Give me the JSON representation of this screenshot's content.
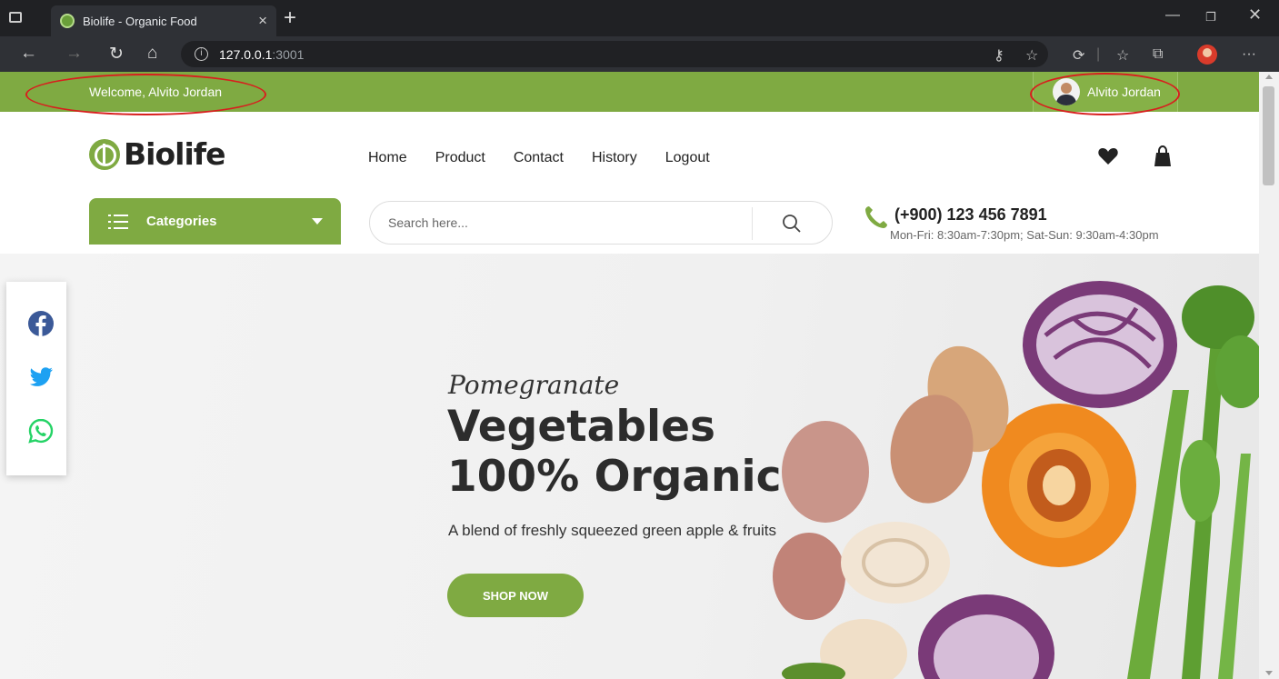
{
  "browser": {
    "tab_title": "Biolife - Organic Food",
    "url_host": "127.0.0.1",
    "url_port": ":3001"
  },
  "topbar": {
    "welcome": "Welcome, Alvito Jordan",
    "username": "Alvito Jordan"
  },
  "header": {
    "logo": "Biolife",
    "nav": [
      "Home",
      "Product",
      "Contact",
      "History",
      "Logout"
    ]
  },
  "categories": {
    "label": "Categories"
  },
  "search": {
    "placeholder": "Search here..."
  },
  "contact": {
    "phone": "(+900) 123 456 7891",
    "hours": "Mon-Fri: 8:30am-7:30pm; Sat-Sun: 9:30am-4:30pm"
  },
  "hero": {
    "subtitle": "Pomegranate",
    "title_line1": "Vegetables",
    "title_line2": "100% Organic",
    "description": "A blend of freshly squeezed green apple & fruits",
    "button": "SHOP NOW"
  },
  "social": [
    "facebook-icon",
    "twitter-icon",
    "whatsapp-icon"
  ],
  "colors": {
    "brand_green": "#7faa42",
    "facebook": "#3b5998",
    "twitter": "#1da1f2",
    "whatsapp": "#25d366",
    "annotation_red": "#d81e1e"
  }
}
